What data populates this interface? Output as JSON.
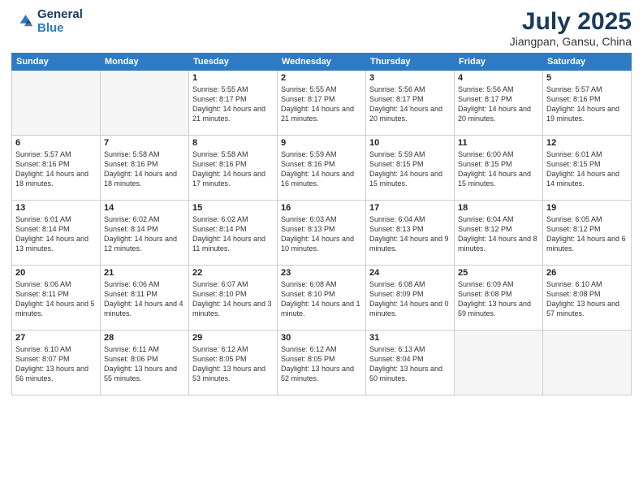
{
  "header": {
    "logo_general": "General",
    "logo_blue": "Blue",
    "month_year": "July 2025",
    "location": "Jiangpan, Gansu, China"
  },
  "weekdays": [
    "Sunday",
    "Monday",
    "Tuesday",
    "Wednesday",
    "Thursday",
    "Friday",
    "Saturday"
  ],
  "weeks": [
    [
      {
        "day": "",
        "info": ""
      },
      {
        "day": "",
        "info": ""
      },
      {
        "day": "1",
        "info": "Sunrise: 5:55 AM\nSunset: 8:17 PM\nDaylight: 14 hours and 21 minutes."
      },
      {
        "day": "2",
        "info": "Sunrise: 5:55 AM\nSunset: 8:17 PM\nDaylight: 14 hours and 21 minutes."
      },
      {
        "day": "3",
        "info": "Sunrise: 5:56 AM\nSunset: 8:17 PM\nDaylight: 14 hours and 20 minutes."
      },
      {
        "day": "4",
        "info": "Sunrise: 5:56 AM\nSunset: 8:17 PM\nDaylight: 14 hours and 20 minutes."
      },
      {
        "day": "5",
        "info": "Sunrise: 5:57 AM\nSunset: 8:16 PM\nDaylight: 14 hours and 19 minutes."
      }
    ],
    [
      {
        "day": "6",
        "info": "Sunrise: 5:57 AM\nSunset: 8:16 PM\nDaylight: 14 hours and 18 minutes."
      },
      {
        "day": "7",
        "info": "Sunrise: 5:58 AM\nSunset: 8:16 PM\nDaylight: 14 hours and 18 minutes."
      },
      {
        "day": "8",
        "info": "Sunrise: 5:58 AM\nSunset: 8:16 PM\nDaylight: 14 hours and 17 minutes."
      },
      {
        "day": "9",
        "info": "Sunrise: 5:59 AM\nSunset: 8:16 PM\nDaylight: 14 hours and 16 minutes."
      },
      {
        "day": "10",
        "info": "Sunrise: 5:59 AM\nSunset: 8:15 PM\nDaylight: 14 hours and 15 minutes."
      },
      {
        "day": "11",
        "info": "Sunrise: 6:00 AM\nSunset: 8:15 PM\nDaylight: 14 hours and 15 minutes."
      },
      {
        "day": "12",
        "info": "Sunrise: 6:01 AM\nSunset: 8:15 PM\nDaylight: 14 hours and 14 minutes."
      }
    ],
    [
      {
        "day": "13",
        "info": "Sunrise: 6:01 AM\nSunset: 8:14 PM\nDaylight: 14 hours and 13 minutes."
      },
      {
        "day": "14",
        "info": "Sunrise: 6:02 AM\nSunset: 8:14 PM\nDaylight: 14 hours and 12 minutes."
      },
      {
        "day": "15",
        "info": "Sunrise: 6:02 AM\nSunset: 8:14 PM\nDaylight: 14 hours and 11 minutes."
      },
      {
        "day": "16",
        "info": "Sunrise: 6:03 AM\nSunset: 8:13 PM\nDaylight: 14 hours and 10 minutes."
      },
      {
        "day": "17",
        "info": "Sunrise: 6:04 AM\nSunset: 8:13 PM\nDaylight: 14 hours and 9 minutes."
      },
      {
        "day": "18",
        "info": "Sunrise: 6:04 AM\nSunset: 8:12 PM\nDaylight: 14 hours and 8 minutes."
      },
      {
        "day": "19",
        "info": "Sunrise: 6:05 AM\nSunset: 8:12 PM\nDaylight: 14 hours and 6 minutes."
      }
    ],
    [
      {
        "day": "20",
        "info": "Sunrise: 6:06 AM\nSunset: 8:11 PM\nDaylight: 14 hours and 5 minutes."
      },
      {
        "day": "21",
        "info": "Sunrise: 6:06 AM\nSunset: 8:11 PM\nDaylight: 14 hours and 4 minutes."
      },
      {
        "day": "22",
        "info": "Sunrise: 6:07 AM\nSunset: 8:10 PM\nDaylight: 14 hours and 3 minutes."
      },
      {
        "day": "23",
        "info": "Sunrise: 6:08 AM\nSunset: 8:10 PM\nDaylight: 14 hours and 1 minute."
      },
      {
        "day": "24",
        "info": "Sunrise: 6:08 AM\nSunset: 8:09 PM\nDaylight: 14 hours and 0 minutes."
      },
      {
        "day": "25",
        "info": "Sunrise: 6:09 AM\nSunset: 8:08 PM\nDaylight: 13 hours and 59 minutes."
      },
      {
        "day": "26",
        "info": "Sunrise: 6:10 AM\nSunset: 8:08 PM\nDaylight: 13 hours and 57 minutes."
      }
    ],
    [
      {
        "day": "27",
        "info": "Sunrise: 6:10 AM\nSunset: 8:07 PM\nDaylight: 13 hours and 56 minutes."
      },
      {
        "day": "28",
        "info": "Sunrise: 6:11 AM\nSunset: 8:06 PM\nDaylight: 13 hours and 55 minutes."
      },
      {
        "day": "29",
        "info": "Sunrise: 6:12 AM\nSunset: 8:05 PM\nDaylight: 13 hours and 53 minutes."
      },
      {
        "day": "30",
        "info": "Sunrise: 6:12 AM\nSunset: 8:05 PM\nDaylight: 13 hours and 52 minutes."
      },
      {
        "day": "31",
        "info": "Sunrise: 6:13 AM\nSunset: 8:04 PM\nDaylight: 13 hours and 50 minutes."
      },
      {
        "day": "",
        "info": ""
      },
      {
        "day": "",
        "info": ""
      }
    ]
  ]
}
